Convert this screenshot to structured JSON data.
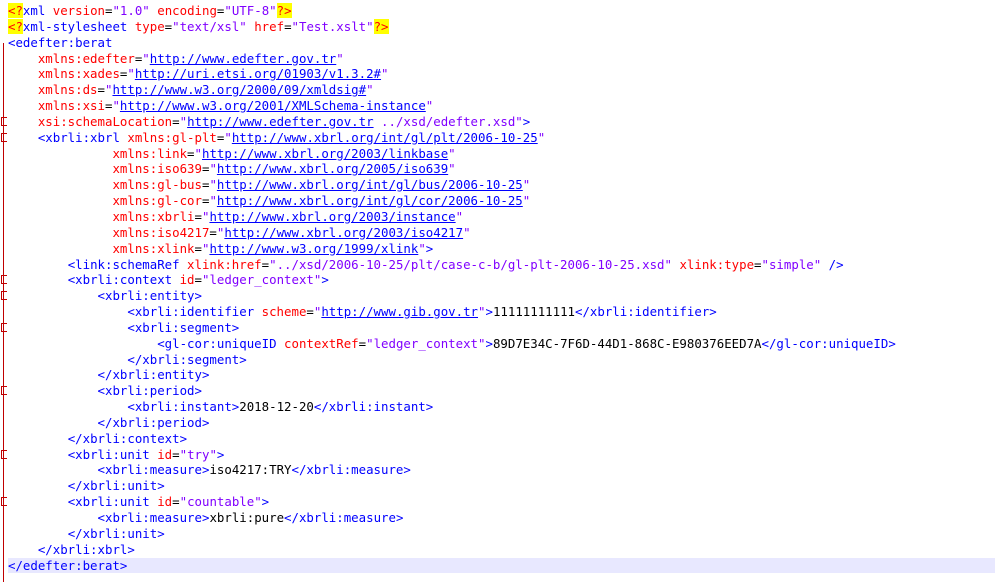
{
  "editor": {
    "language": "XML",
    "current_line": 35,
    "lines": [
      {
        "indent": 0,
        "tokens": [
          {
            "c": "pi",
            "s": "<?"
          },
          {
            "c": "t",
            "s": "xml "
          },
          {
            "c": "a",
            "s": "version"
          },
          {
            "c": "x",
            "s": "="
          },
          {
            "c": "v",
            "s": "\"1.0\""
          },
          {
            "c": "x",
            "s": " "
          },
          {
            "c": "a",
            "s": "encoding"
          },
          {
            "c": "x",
            "s": "="
          },
          {
            "c": "v",
            "s": "\"UTF-8\""
          },
          {
            "c": "pi",
            "s": "?>"
          }
        ]
      },
      {
        "indent": 0,
        "tokens": [
          {
            "c": "pi",
            "s": "<?"
          },
          {
            "c": "t",
            "s": "xml-stylesheet "
          },
          {
            "c": "a",
            "s": "type"
          },
          {
            "c": "x",
            "s": "="
          },
          {
            "c": "v",
            "s": "\"text/xsl\""
          },
          {
            "c": "x",
            "s": " "
          },
          {
            "c": "a",
            "s": "href"
          },
          {
            "c": "x",
            "s": "="
          },
          {
            "c": "v",
            "s": "\"Test.xslt\""
          },
          {
            "c": "pi",
            "s": "?>"
          }
        ]
      },
      {
        "indent": 0,
        "tokens": [
          {
            "c": "t",
            "s": "<edefter:berat"
          }
        ]
      },
      {
        "indent": 4,
        "tokens": [
          {
            "c": "a",
            "s": "xmlns:edefter"
          },
          {
            "c": "x",
            "s": "="
          },
          {
            "c": "v",
            "s": "\""
          },
          {
            "c": "u",
            "s": "http://www.edefter.gov.tr"
          },
          {
            "c": "v",
            "s": "\""
          }
        ]
      },
      {
        "indent": 4,
        "tokens": [
          {
            "c": "a",
            "s": "xmlns:xades"
          },
          {
            "c": "x",
            "s": "="
          },
          {
            "c": "v",
            "s": "\""
          },
          {
            "c": "u",
            "s": "http://uri.etsi.org/01903/v1.3.2#"
          },
          {
            "c": "v",
            "s": "\""
          }
        ]
      },
      {
        "indent": 4,
        "tokens": [
          {
            "c": "a",
            "s": "xmlns:ds"
          },
          {
            "c": "x",
            "s": "="
          },
          {
            "c": "v",
            "s": "\""
          },
          {
            "c": "u",
            "s": "http://www.w3.org/2000/09/xmldsig#"
          },
          {
            "c": "v",
            "s": "\""
          }
        ]
      },
      {
        "indent": 4,
        "tokens": [
          {
            "c": "a",
            "s": "xmlns:xsi"
          },
          {
            "c": "x",
            "s": "="
          },
          {
            "c": "v",
            "s": "\""
          },
          {
            "c": "u",
            "s": "http://www.w3.org/2001/XMLSchema-instance"
          },
          {
            "c": "v",
            "s": "\""
          }
        ]
      },
      {
        "indent": 4,
        "tokens": [
          {
            "c": "a",
            "s": "xsi:schemaLocation"
          },
          {
            "c": "x",
            "s": "="
          },
          {
            "c": "v",
            "s": "\""
          },
          {
            "c": "u",
            "s": "http://www.edefter.gov.tr"
          },
          {
            "c": "v",
            "s": " ../xsd/edefter.xsd\""
          },
          {
            "c": "t",
            "s": ">"
          }
        ]
      },
      {
        "indent": 4,
        "tokens": [
          {
            "c": "t",
            "s": "<xbrli:xbrl "
          },
          {
            "c": "a",
            "s": "xmlns:gl-plt"
          },
          {
            "c": "x",
            "s": "="
          },
          {
            "c": "v",
            "s": "\""
          },
          {
            "c": "u",
            "s": "http://www.xbrl.org/int/gl/plt/2006-10-25"
          },
          {
            "c": "v",
            "s": "\""
          }
        ]
      },
      {
        "indent": 14,
        "tokens": [
          {
            "c": "a",
            "s": "xmlns:link"
          },
          {
            "c": "x",
            "s": "="
          },
          {
            "c": "v",
            "s": "\""
          },
          {
            "c": "u",
            "s": "http://www.xbrl.org/2003/linkbase"
          },
          {
            "c": "v",
            "s": "\""
          }
        ]
      },
      {
        "indent": 14,
        "tokens": [
          {
            "c": "a",
            "s": "xmlns:iso639"
          },
          {
            "c": "x",
            "s": "="
          },
          {
            "c": "v",
            "s": "\""
          },
          {
            "c": "u",
            "s": "http://www.xbrl.org/2005/iso639"
          },
          {
            "c": "v",
            "s": "\""
          }
        ]
      },
      {
        "indent": 14,
        "tokens": [
          {
            "c": "a",
            "s": "xmlns:gl-bus"
          },
          {
            "c": "x",
            "s": "="
          },
          {
            "c": "v",
            "s": "\""
          },
          {
            "c": "u",
            "s": "http://www.xbrl.org/int/gl/bus/2006-10-25"
          },
          {
            "c": "v",
            "s": "\""
          }
        ]
      },
      {
        "indent": 14,
        "tokens": [
          {
            "c": "a",
            "s": "xmlns:gl-cor"
          },
          {
            "c": "x",
            "s": "="
          },
          {
            "c": "v",
            "s": "\""
          },
          {
            "c": "u",
            "s": "http://www.xbrl.org/int/gl/cor/2006-10-25"
          },
          {
            "c": "v",
            "s": "\""
          }
        ]
      },
      {
        "indent": 14,
        "tokens": [
          {
            "c": "a",
            "s": "xmlns:xbrli"
          },
          {
            "c": "x",
            "s": "="
          },
          {
            "c": "v",
            "s": "\""
          },
          {
            "c": "u",
            "s": "http://www.xbrl.org/2003/instance"
          },
          {
            "c": "v",
            "s": "\""
          }
        ]
      },
      {
        "indent": 14,
        "tokens": [
          {
            "c": "a",
            "s": "xmlns:iso4217"
          },
          {
            "c": "x",
            "s": "="
          },
          {
            "c": "v",
            "s": "\""
          },
          {
            "c": "u",
            "s": "http://www.xbrl.org/2003/iso4217"
          },
          {
            "c": "v",
            "s": "\""
          }
        ]
      },
      {
        "indent": 14,
        "tokens": [
          {
            "c": "a",
            "s": "xmlns:xlink"
          },
          {
            "c": "x",
            "s": "="
          },
          {
            "c": "v",
            "s": "\""
          },
          {
            "c": "u",
            "s": "http://www.w3.org/1999/xlink"
          },
          {
            "c": "v",
            "s": "\""
          },
          {
            "c": "t",
            "s": ">"
          }
        ]
      },
      {
        "indent": 8,
        "tokens": [
          {
            "c": "t",
            "s": "<link:schemaRef "
          },
          {
            "c": "a",
            "s": "xlink:href"
          },
          {
            "c": "x",
            "s": "="
          },
          {
            "c": "v",
            "s": "\"../xsd/2006-10-25/plt/case-c-b/gl-plt-2006-10-25.xsd\""
          },
          {
            "c": "x",
            "s": " "
          },
          {
            "c": "a",
            "s": "xlink:type"
          },
          {
            "c": "x",
            "s": "="
          },
          {
            "c": "v",
            "s": "\"simple\""
          },
          {
            "c": "x",
            "s": " "
          },
          {
            "c": "t",
            "s": "/>"
          }
        ]
      },
      {
        "indent": 8,
        "tokens": [
          {
            "c": "t",
            "s": "<xbrli:context "
          },
          {
            "c": "a",
            "s": "id"
          },
          {
            "c": "x",
            "s": "="
          },
          {
            "c": "v",
            "s": "\"ledger_context\""
          },
          {
            "c": "t",
            "s": ">"
          }
        ]
      },
      {
        "indent": 12,
        "tokens": [
          {
            "c": "t",
            "s": "<xbrli:entity>"
          }
        ]
      },
      {
        "indent": 16,
        "tokens": [
          {
            "c": "t",
            "s": "<xbrli:identifier "
          },
          {
            "c": "a",
            "s": "scheme"
          },
          {
            "c": "x",
            "s": "="
          },
          {
            "c": "v",
            "s": "\""
          },
          {
            "c": "u",
            "s": "http://www.gib.gov.tr"
          },
          {
            "c": "v",
            "s": "\""
          },
          {
            "c": "t",
            "s": ">"
          },
          {
            "c": "x",
            "s": "11111111111"
          },
          {
            "c": "t",
            "s": "</xbrli:identifier>"
          }
        ]
      },
      {
        "indent": 16,
        "tokens": [
          {
            "c": "t",
            "s": "<xbrli:segment>"
          }
        ]
      },
      {
        "indent": 20,
        "tokens": [
          {
            "c": "t",
            "s": "<gl-cor:uniqueID "
          },
          {
            "c": "a",
            "s": "contextRef"
          },
          {
            "c": "x",
            "s": "="
          },
          {
            "c": "v",
            "s": "\"ledger_context\""
          },
          {
            "c": "t",
            "s": ">"
          },
          {
            "c": "x",
            "s": "89D7E34C-7F6D-44D1-868C-E980376EED7A"
          },
          {
            "c": "t",
            "s": "</gl-cor:uniqueID>"
          }
        ]
      },
      {
        "indent": 16,
        "tokens": [
          {
            "c": "t",
            "s": "</xbrli:segment>"
          }
        ]
      },
      {
        "indent": 12,
        "tokens": [
          {
            "c": "t",
            "s": "</xbrli:entity>"
          }
        ]
      },
      {
        "indent": 12,
        "tokens": [
          {
            "c": "t",
            "s": "<xbrli:period>"
          }
        ]
      },
      {
        "indent": 16,
        "tokens": [
          {
            "c": "t",
            "s": "<xbrli:instant>"
          },
          {
            "c": "x",
            "s": "2018-12-20"
          },
          {
            "c": "t",
            "s": "</xbrli:instant>"
          }
        ]
      },
      {
        "indent": 12,
        "tokens": [
          {
            "c": "t",
            "s": "</xbrli:period>"
          }
        ]
      },
      {
        "indent": 8,
        "tokens": [
          {
            "c": "t",
            "s": "</xbrli:context>"
          }
        ]
      },
      {
        "indent": 8,
        "tokens": [
          {
            "c": "t",
            "s": "<xbrli:unit "
          },
          {
            "c": "a",
            "s": "id"
          },
          {
            "c": "x",
            "s": "="
          },
          {
            "c": "v",
            "s": "\"try\""
          },
          {
            "c": "t",
            "s": ">"
          }
        ]
      },
      {
        "indent": 12,
        "tokens": [
          {
            "c": "t",
            "s": "<xbrli:measure>"
          },
          {
            "c": "x",
            "s": "iso4217:TRY"
          },
          {
            "c": "t",
            "s": "</xbrli:measure>"
          }
        ]
      },
      {
        "indent": 8,
        "tokens": [
          {
            "c": "t",
            "s": "</xbrli:unit>"
          }
        ]
      },
      {
        "indent": 8,
        "tokens": [
          {
            "c": "t",
            "s": "<xbrli:unit "
          },
          {
            "c": "a",
            "s": "id"
          },
          {
            "c": "x",
            "s": "="
          },
          {
            "c": "v",
            "s": "\"countable\""
          },
          {
            "c": "t",
            "s": ">"
          }
        ]
      },
      {
        "indent": 12,
        "tokens": [
          {
            "c": "t",
            "s": "<xbrli:measure>"
          },
          {
            "c": "x",
            "s": "xbrli:pure"
          },
          {
            "c": "t",
            "s": "</xbrli:measure>"
          }
        ]
      },
      {
        "indent": 8,
        "tokens": [
          {
            "c": "t",
            "s": "</xbrli:unit>"
          }
        ]
      },
      {
        "indent": 4,
        "tokens": [
          {
            "c": "t",
            "s": "</xbrli:xbrl>"
          }
        ]
      },
      {
        "indent": 0,
        "tokens": [
          {
            "c": "t",
            "s": "</edefter:berat>"
          }
        ]
      }
    ]
  }
}
